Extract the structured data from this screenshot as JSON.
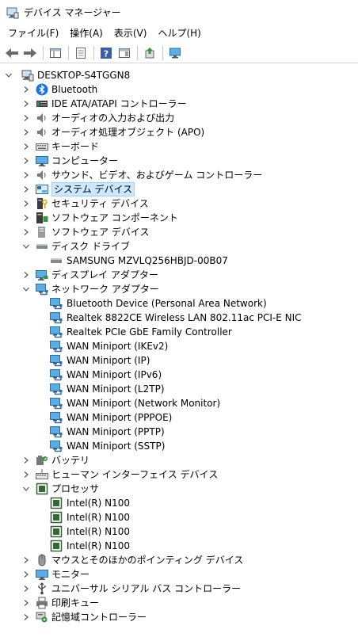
{
  "window": {
    "title": "デバイス マネージャー"
  },
  "menu": [
    "ファイル(F)",
    "操作(A)",
    "表示(V)",
    "ヘルプ(H)"
  ],
  "toolbar": [
    "back-icon",
    "forward-icon",
    "properties-panel-icon",
    "properties-icon",
    "help-icon",
    "action-panel-icon",
    "update-driver-icon",
    "monitor-scan-icon"
  ],
  "tree": {
    "root": "DESKTOP-S4TGGN8",
    "categories": [
      {
        "label": "Bluetooth",
        "icon": "bluetooth-icon",
        "expanded": false
      },
      {
        "label": "IDE ATA/ATAPI コントローラー",
        "icon": "ide-controller-icon",
        "expanded": false
      },
      {
        "label": "オーディオの入力および出力",
        "icon": "speaker-icon",
        "expanded": false
      },
      {
        "label": "オーディオ処理オブジェクト (APO)",
        "icon": "speaker-icon",
        "expanded": false
      },
      {
        "label": "キーボード",
        "icon": "keyboard-icon",
        "expanded": false
      },
      {
        "label": "コンピューター",
        "icon": "computer-icon",
        "expanded": false
      },
      {
        "label": "サウンド、ビデオ、およびゲーム コントローラー",
        "icon": "speaker-icon",
        "expanded": false
      },
      {
        "label": "システム デバイス",
        "icon": "system-device-icon",
        "expanded": false,
        "selected": true
      },
      {
        "label": "セキュリティ デバイス",
        "icon": "security-icon",
        "expanded": false
      },
      {
        "label": "ソフトウェア コンポーネント",
        "icon": "software-component-icon",
        "expanded": false
      },
      {
        "label": "ソフトウェア デバイス",
        "icon": "software-device-icon",
        "expanded": false
      },
      {
        "label": "ディスク ドライブ",
        "icon": "disk-drive-icon",
        "expanded": true,
        "children": [
          "SAMSUNG MZVLQ256HBJD-00B07"
        ]
      },
      {
        "label": "ディスプレイ アダプター",
        "icon": "display-adapter-icon",
        "expanded": false
      },
      {
        "label": "ネットワーク アダプター",
        "icon": "network-adapter-icon",
        "expanded": true,
        "children": [
          "Bluetooth Device (Personal Area Network)",
          "Realtek 8822CE Wireless LAN 802.11ac PCI-E NIC",
          "Realtek PCIe GbE Family Controller",
          "WAN Miniport (IKEv2)",
          "WAN Miniport (IP)",
          "WAN Miniport (IPv6)",
          "WAN Miniport (L2TP)",
          "WAN Miniport (Network Monitor)",
          "WAN Miniport (PPPOE)",
          "WAN Miniport (PPTP)",
          "WAN Miniport (SSTP)"
        ]
      },
      {
        "label": "バッテリ",
        "icon": "battery-icon",
        "expanded": false
      },
      {
        "label": "ヒューマン インターフェイス デバイス",
        "icon": "hid-icon",
        "expanded": false
      },
      {
        "label": "プロセッサ",
        "icon": "processor-icon",
        "expanded": true,
        "children": [
          "Intel(R) N100",
          "Intel(R) N100",
          "Intel(R) N100",
          "Intel(R) N100"
        ]
      },
      {
        "label": "マウスとそのほかのポインティング デバイス",
        "icon": "mouse-icon",
        "expanded": false
      },
      {
        "label": "モニター",
        "icon": "monitor-icon",
        "expanded": false
      },
      {
        "label": "ユニバーサル シリアル バス コントローラー",
        "icon": "usb-icon",
        "expanded": false
      },
      {
        "label": "印刷キュー",
        "icon": "printer-icon",
        "expanded": false
      },
      {
        "label": "記憶域コントローラー",
        "icon": "storage-controller-icon",
        "expanded": false
      }
    ]
  },
  "colors": {
    "selection_bg": "#cce8ff",
    "selection_border": "#99d1ff",
    "accent": "#0078d7"
  }
}
